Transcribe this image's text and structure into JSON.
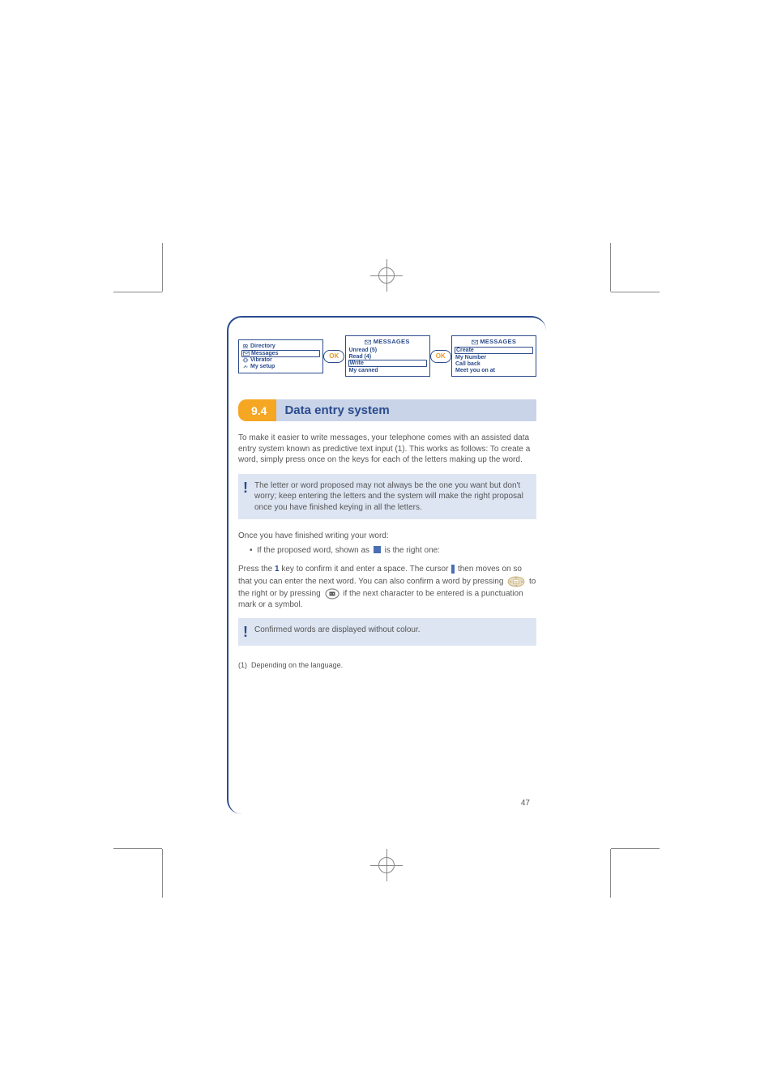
{
  "screens": {
    "menu": {
      "items": [
        {
          "icon": "people",
          "label": "Directory"
        },
        {
          "icon": "envelope",
          "label": "Messages",
          "boxed": true
        },
        {
          "icon": "vibrator",
          "label": "Vibrator"
        },
        {
          "icon": "tools",
          "label": "My setup"
        }
      ]
    },
    "messages1": {
      "header": "MESSAGES",
      "items": [
        {
          "label": "Unread (5)"
        },
        {
          "label": "Read (4)"
        },
        {
          "label": "Write",
          "boxed": true
        },
        {
          "label": "My canned"
        }
      ]
    },
    "messages2": {
      "header": "MESSAGES",
      "items": [
        {
          "label": "Create",
          "boxed": true
        },
        {
          "label": "My Number"
        },
        {
          "label": "Call back"
        },
        {
          "label": "Meet you on   at"
        }
      ]
    }
  },
  "ok_label": "OK",
  "section": {
    "num": "9.4",
    "title": "Data entry system"
  },
  "para1": "To make it easier to write messages, your telephone comes with an assisted data entry system known as predictive text input (1). This works as follows: To create a word, simply press once on the keys for each of the letters making up the word.",
  "info1": "The letter or word proposed may not always be the one you want but don't worry; keep entering the letters and the system will make the right proposal once you have finished keying in all the letters.",
  "para2_a": "Once you have finished writing your word:",
  "para2_b_prefix": "If the proposed word, shown as  ",
  "para2_b_suffix": "  is the right one:",
  "para3_prefix": "Press the ",
  "para3_mid": " key to confirm it and enter a space. The cursor ",
  "para3_cont": " then moves on so that you can enter the next word. You can also confirm a word by pressing ",
  "para3_after_nav": " to the right or by pressing ",
  "para3_end": " if the next character to be entered is a punctuation mark or a symbol.",
  "info2": "Confirmed words are displayed without colour.",
  "footnote_marker": "(1)",
  "footnote": "Depending on the language.",
  "page_num": "47",
  "key_1": "1"
}
